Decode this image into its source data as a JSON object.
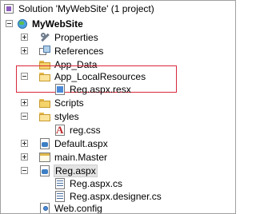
{
  "tree": {
    "solution": "Solution 'MyWebSite' (1 project)",
    "project": "MyWebSite",
    "properties": "Properties",
    "references": "References",
    "app_data": "App_Data",
    "app_localresources": "App_LocalResources",
    "reg_aspx_resx": "Reg.aspx.resx",
    "scripts": "Scripts",
    "styles": "styles",
    "reg_css": "reg.css",
    "default_aspx": "Default.aspx",
    "main_master": "main.Master",
    "reg_aspx": "Reg.aspx",
    "reg_aspx_cs": "Reg.aspx.cs",
    "reg_aspx_designer_cs": "Reg.aspx.designer.cs",
    "web_config": "Web.config"
  },
  "colors": {
    "highlight_border": "#d8283a",
    "selection_bg": "#e3e3e3"
  },
  "selected_item": "Reg.aspx"
}
